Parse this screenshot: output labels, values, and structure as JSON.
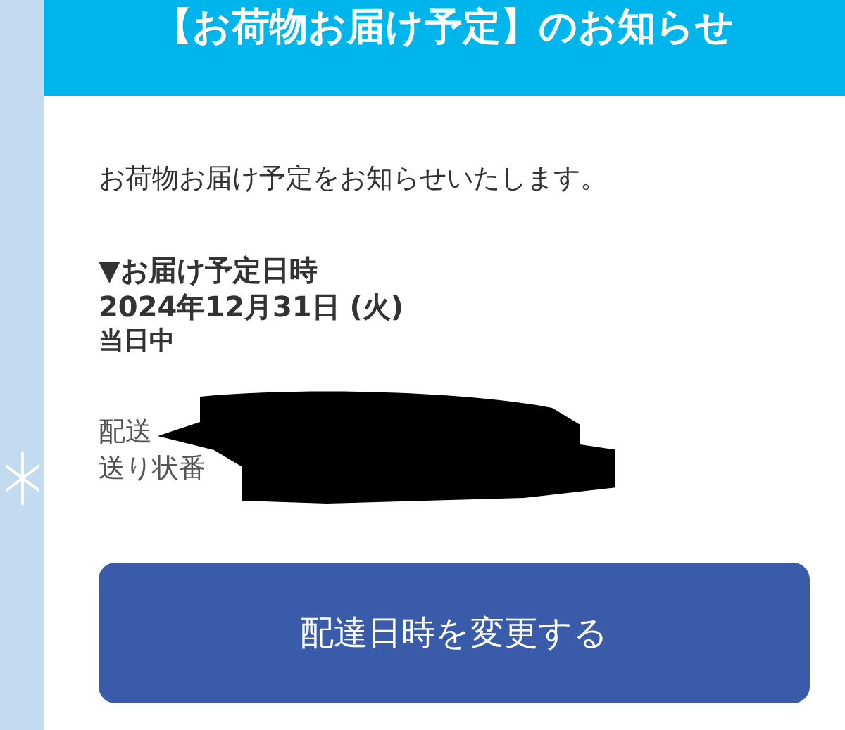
{
  "header": {
    "title": "【お荷物お届け予定】のお知らせ"
  },
  "intro": "お荷物お届け予定をお知らせいたします。",
  "delivery": {
    "heading": "▼お届け予定日時",
    "date": "2024年12月31日 (火)",
    "time": "当日中"
  },
  "details": [
    "配送",
    "送り状番"
  ],
  "button": {
    "label": "配達日時を変更する"
  }
}
